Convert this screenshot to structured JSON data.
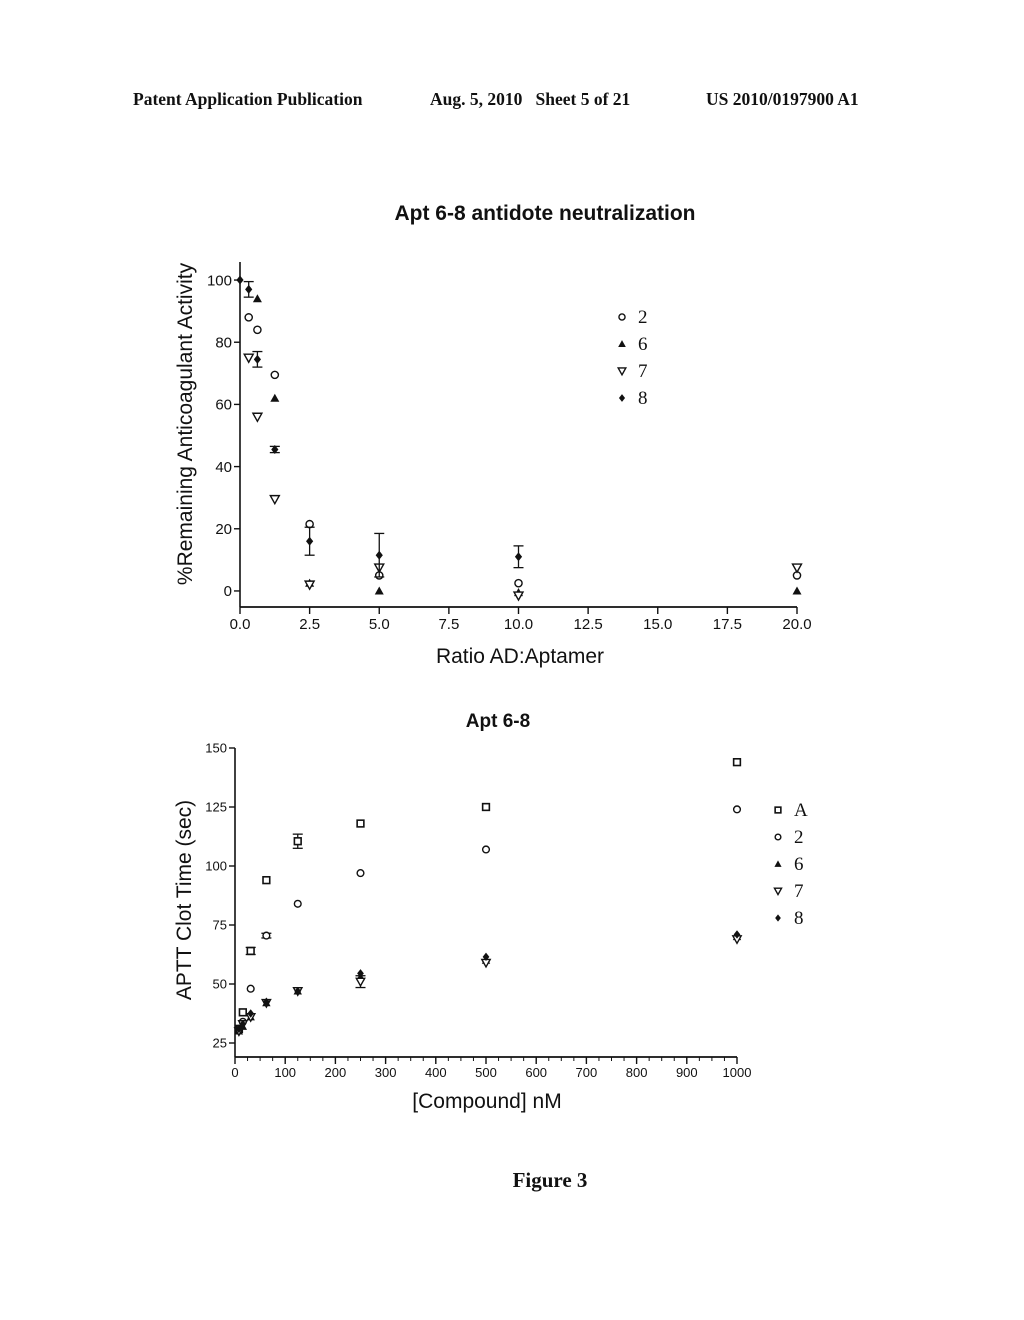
{
  "header": {
    "left": "Patent Application Publication",
    "middle": "Aug. 5, 2010   Sheet 5 of 21",
    "right": "US 2010/0197900 A1"
  },
  "figure_label": "Figure 3",
  "chart_data": [
    {
      "type": "scatter",
      "title": "Apt 6-8 antidote neutralization",
      "xlabel": "Ratio AD:Aptamer",
      "ylabel": "%Remaining Anticoagulant Activity",
      "xlim": [
        0,
        20
      ],
      "ylim": [
        -5,
        105
      ],
      "xticks": [
        0,
        2.5,
        5,
        7.5,
        10,
        12.5,
        15,
        17.5,
        20
      ],
      "xtick_labels": [
        "0.0",
        "2.5",
        "5.0",
        "7.5",
        "10.0",
        "12.5",
        "15.0",
        "17.5",
        "20.0"
      ],
      "yticks": [
        0,
        20,
        40,
        60,
        80,
        100
      ],
      "ytick_labels": [
        "0",
        "20",
        "40",
        "60",
        "80",
        "100"
      ],
      "grid": false,
      "legend_position": "top-right",
      "series": [
        {
          "name": "2",
          "marker": "circle-open",
          "points": [
            [
              0.3125,
              88
            ],
            [
              0.625,
              84
            ],
            [
              1.25,
              69.5
            ],
            [
              2.5,
              21.5
            ],
            [
              5,
              5
            ],
            [
              10,
              2.5
            ],
            [
              20,
              5
            ]
          ]
        },
        {
          "name": "6",
          "marker": "triangle-up-filled",
          "points": [
            [
              0.625,
              94
            ],
            [
              1.25,
              62
            ],
            [
              2.5,
              2.5
            ],
            [
              5,
              0
            ],
            [
              10,
              -0.5
            ],
            [
              20,
              0
            ]
          ]
        },
        {
          "name": "7",
          "marker": "triangle-down-open",
          "points": [
            [
              0.3125,
              75
            ],
            [
              0.625,
              56
            ],
            [
              1.25,
              29.5
            ],
            [
              2.5,
              2
            ],
            [
              5,
              7.5
            ],
            [
              10,
              -1.5
            ],
            [
              20,
              7.5
            ]
          ]
        },
        {
          "name": "8",
          "marker": "diamond-filled",
          "points": [
            [
              0,
              100
            ],
            [
              0.3125,
              97
            ],
            [
              0.625,
              74.5
            ],
            [
              1.25,
              45.5
            ],
            [
              2.5,
              16
            ],
            [
              5,
              11.5
            ],
            [
              10,
              11
            ]
          ],
          "errors": [
            0,
            2.5,
            2.5,
            1,
            4.5,
            7,
            3.5
          ]
        }
      ]
    },
    {
      "type": "scatter",
      "title": "Apt 6-8",
      "xlabel": "[Compound] nM",
      "ylabel": "APTT Clot Time (sec)",
      "xlim": [
        0,
        1000
      ],
      "ylim": [
        25,
        150
      ],
      "xticks": [
        0,
        100,
        200,
        300,
        400,
        500,
        600,
        700,
        800,
        900,
        1000
      ],
      "xtick_labels": [
        "0",
        "100",
        "200",
        "300",
        "400",
        "500",
        "600",
        "700",
        "800",
        "900",
        "1000"
      ],
      "x_minor_step": 25,
      "yticks": [
        25,
        50,
        75,
        100,
        125,
        150
      ],
      "ytick_labels": [
        "25",
        "50",
        "75",
        "100",
        "125",
        "150"
      ],
      "grid": false,
      "legend_position": "right",
      "series": [
        {
          "name": "A",
          "marker": "square-open",
          "points": [
            [
              7.8,
              31
            ],
            [
              15.6,
              38
            ],
            [
              31.25,
              64
            ],
            [
              62.5,
              94
            ],
            [
              125,
              110.5
            ],
            [
              250,
              118
            ],
            [
              500,
              125
            ],
            [
              1000,
              144
            ]
          ],
          "errors": [
            0,
            0,
            1.5,
            0,
            3,
            0,
            0,
            0
          ]
        },
        {
          "name": "2",
          "marker": "circle-open",
          "points": [
            [
              7.8,
              31
            ],
            [
              15.6,
              34
            ],
            [
              31.25,
              48
            ],
            [
              62.5,
              70.5
            ],
            [
              125,
              84
            ],
            [
              250,
              97
            ],
            [
              500,
              107
            ],
            [
              1000,
              124
            ]
          ],
          "errors": [
            0,
            0,
            0,
            1,
            0,
            0,
            0,
            0
          ]
        },
        {
          "name": "6",
          "marker": "triangle-up-filled",
          "points": [
            [
              7.8,
              30
            ],
            [
              15.6,
              32
            ],
            [
              31.25,
              36
            ],
            [
              62.5,
              42
            ],
            [
              125,
              47
            ],
            [
              250,
              53
            ],
            [
              500,
              60
            ],
            [
              1000,
              70
            ]
          ]
        },
        {
          "name": "7",
          "marker": "triangle-down-open",
          "points": [
            [
              7.8,
              30
            ],
            [
              15.6,
              33
            ],
            [
              31.25,
              36
            ],
            [
              62.5,
              42
            ],
            [
              125,
              47
            ],
            [
              250,
              51
            ],
            [
              500,
              59
            ],
            [
              1000,
              69
            ]
          ],
          "errors": [
            0,
            0,
            0,
            0,
            0,
            2.5,
            0,
            0
          ]
        },
        {
          "name": "8",
          "marker": "diamond-filled",
          "points": [
            [
              7.8,
              31
            ],
            [
              15.6,
              33
            ],
            [
              31.25,
              37.5
            ],
            [
              62.5,
              42.5
            ],
            [
              125,
              47
            ],
            [
              250,
              54.5
            ],
            [
              500,
              61.5
            ],
            [
              1000,
              71
            ]
          ]
        }
      ]
    }
  ]
}
